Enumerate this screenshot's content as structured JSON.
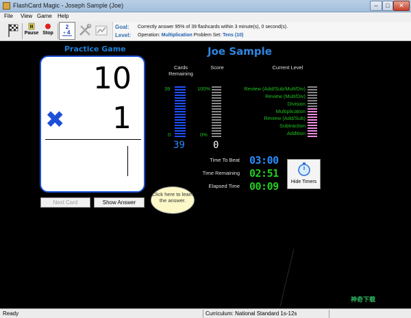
{
  "window": {
    "title": "FlashCard Magic - Joseph  Sample (Joe)",
    "controls": {
      "minimize": "–",
      "maximize": "□",
      "close": "✕"
    }
  },
  "menu": [
    "File",
    "View",
    "Game",
    "Help"
  ],
  "toolbar": {
    "pause_label": "Pause",
    "stop_label": "Stop",
    "icons": [
      "flag-icon",
      "pause-icon",
      "stop-icon",
      "math-select-icon",
      "tools-icon",
      "chart-icon"
    ]
  },
  "goal": {
    "goal_key": "Goal:",
    "goal_text": "Correctly answer 95% of 39 flashcards within 3 minute(s), 0 second(s).",
    "level_key": "Level:",
    "operation_label": "Operation:",
    "operation_value": "Multiplication",
    "problem_set_label": "Problem Set:",
    "problem_set_value": "Tens (10)"
  },
  "practice": {
    "title": "Practice Game",
    "card": {
      "top_number": "10",
      "operator": "✖",
      "bottom_number": "1"
    },
    "next_card_label": "Next Card",
    "show_answer_label": "Show Answer",
    "bubble_text": "Click here to learn the answer."
  },
  "student": {
    "name": "Joe Sample"
  },
  "stats": {
    "cards_remaining_label": "Cards Remaining",
    "cards_remaining_max": "39",
    "cards_remaining_min": "0",
    "cards_remaining_value": "39",
    "cards_remaining_fraction": 1.0,
    "score_label": "Score",
    "score_max": "100%",
    "score_min": "0%",
    "score_value": "0",
    "score_fraction": 0.0,
    "current_level_label": "Current Level",
    "levels": [
      "Review (Add/Sub/Mult/Div)",
      "Review (Mult/Div)",
      "Division",
      "Multiplication",
      "Review (Add/Sub)",
      "Subtraction",
      "Addition"
    ],
    "current_level_index": 3
  },
  "timers": {
    "time_to_beat_label": "Time To Beat",
    "time_to_beat": "03:00",
    "time_remaining_label": "Time Remaining",
    "time_remaining": "02:51",
    "elapsed_label": "Elapsed Time",
    "elapsed": "00:09",
    "hide_timers_label": "Hide Timers"
  },
  "status": {
    "left": "Ready",
    "curriculum": "Curriculum: National Standard 1s-12s"
  },
  "watermark": "神奇下载",
  "colors": {
    "accent": "#1e7fd8",
    "cards_bar": "#1e50ff",
    "level_fill": "#f08ee0",
    "timer_blue": "#2a8cff",
    "timer_green": "#22cc22"
  }
}
